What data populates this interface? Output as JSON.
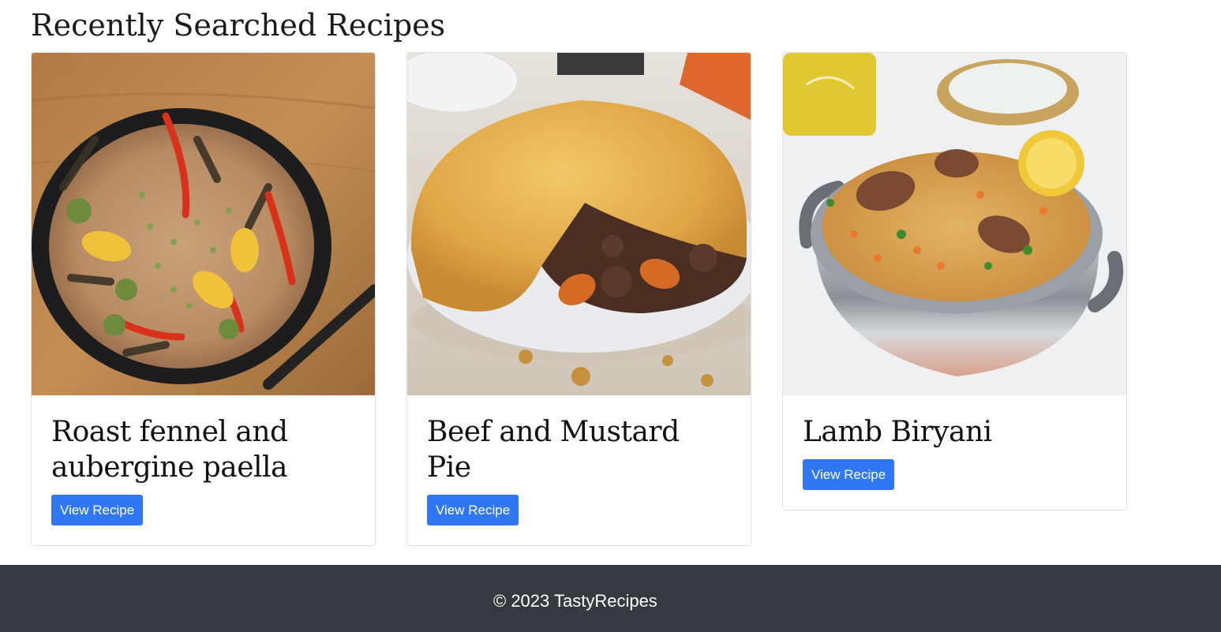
{
  "page": {
    "section_title": "Recently Searched Recipes"
  },
  "recipes": [
    {
      "title": "Roast fennel and aubergine paella",
      "button_label": "View Recipe",
      "image": "paella-photo"
    },
    {
      "title": "Beef and Mustard Pie",
      "button_label": "View Recipe",
      "image": "pie-photo"
    },
    {
      "title": "Lamb Biryani",
      "button_label": "View Recipe",
      "image": "biryani-photo"
    }
  ],
  "footer": {
    "copyright": "© 2023 TastyRecipes"
  },
  "colors": {
    "button": "#3077f6",
    "footer_background": "#343a40",
    "footer_text": "#ffffff"
  }
}
